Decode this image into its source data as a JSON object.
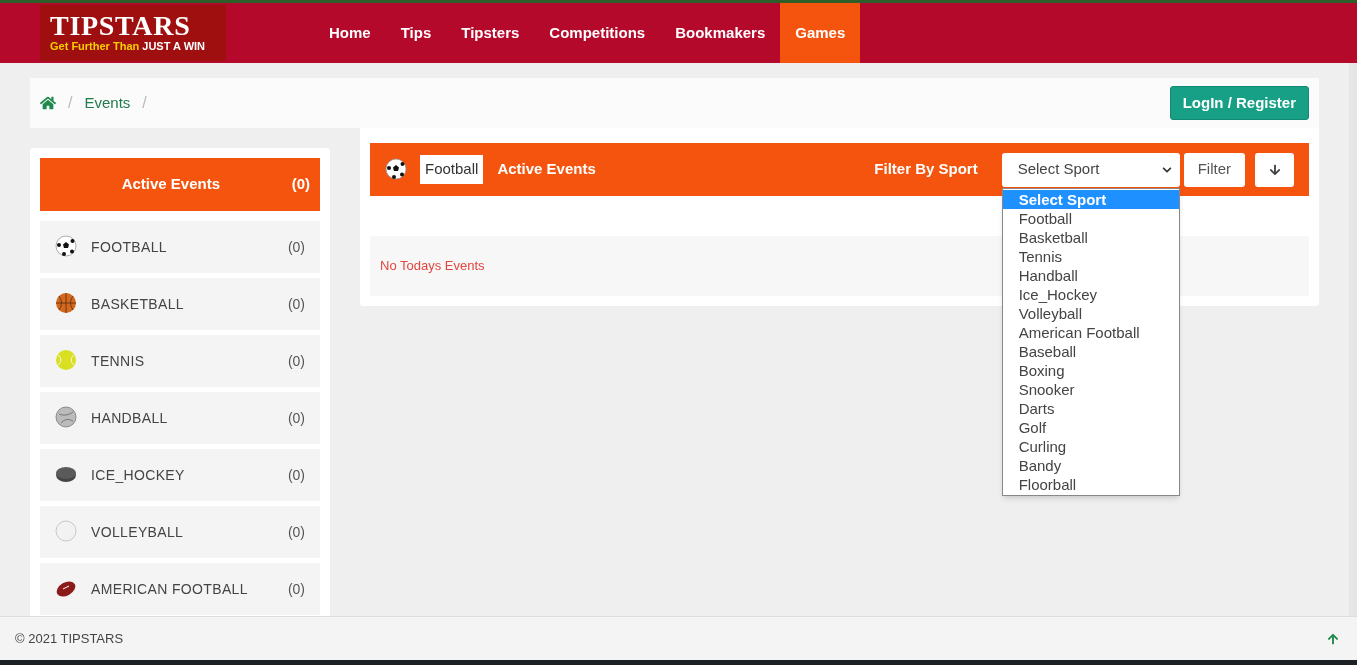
{
  "logo": {
    "title": "TIPSTARS",
    "tagline_start": "Get Further Than",
    "tagline_end": "JUST A WIN"
  },
  "nav": [
    {
      "label": "Home",
      "selected": false
    },
    {
      "label": "Tips",
      "selected": false
    },
    {
      "label": "Tipsters",
      "selected": false
    },
    {
      "label": "Competitions",
      "selected": false
    },
    {
      "label": "Bookmakers",
      "selected": false
    },
    {
      "label": "Games",
      "selected": true
    }
  ],
  "breadcrumb": {
    "items": [
      {
        "kind": "separator",
        "text": "/"
      },
      {
        "kind": "link",
        "text": "Events"
      },
      {
        "kind": "separator",
        "text": "/"
      }
    ]
  },
  "login_button": "LogIn / Register",
  "sidebar": {
    "header": {
      "label": "Active Events",
      "count": "(0)"
    },
    "items": [
      {
        "kind": "football",
        "label": "FOOTBALL",
        "count": "(0)"
      },
      {
        "kind": "basketball",
        "label": "BASKETBALL",
        "count": "(0)"
      },
      {
        "kind": "tennis",
        "label": "TENNIS",
        "count": "(0)"
      },
      {
        "kind": "handball",
        "label": "HANDBALL",
        "count": "(0)"
      },
      {
        "kind": "puck",
        "label": "ICE_HOCKEY",
        "count": "(0)"
      },
      {
        "kind": "volleyball",
        "label": "VOLLEYBALL",
        "count": "(0)"
      },
      {
        "kind": "rugby",
        "label": "AMERICAN FOOTBALL",
        "count": "(0)"
      }
    ]
  },
  "events_panel": {
    "sport_tag": "Football",
    "title": "Active Events",
    "filter_label": "Filter By Sport",
    "select": {
      "value": "Select Sport",
      "expanded": true,
      "options": [
        {
          "label": "Select Sport",
          "selected": true
        },
        {
          "label": "Football",
          "selected": false
        },
        {
          "label": "Basketball",
          "selected": false
        },
        {
          "label": "Tennis",
          "selected": false
        },
        {
          "label": "Handball",
          "selected": false
        },
        {
          "label": "Ice_Hockey",
          "selected": false
        },
        {
          "label": "Volleyball",
          "selected": false
        },
        {
          "label": "American Football",
          "selected": false
        },
        {
          "label": "Baseball",
          "selected": false
        },
        {
          "label": "Boxing",
          "selected": false
        },
        {
          "label": "Snooker",
          "selected": false
        },
        {
          "label": "Darts",
          "selected": false
        },
        {
          "label": "Golf",
          "selected": false
        },
        {
          "label": "Curling",
          "selected": false
        },
        {
          "label": "Bandy",
          "selected": false
        },
        {
          "label": "Floorball",
          "selected": false
        }
      ]
    },
    "filter_button": "Filter",
    "empty_message": "No Todays Events"
  },
  "footer": {
    "copyright": "© 2021 TIPSTARS"
  }
}
